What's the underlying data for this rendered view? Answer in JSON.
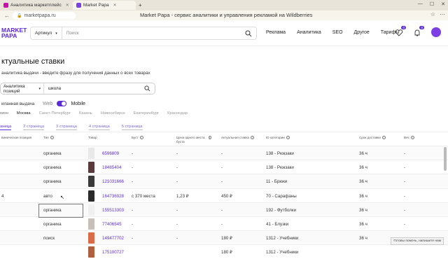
{
  "browser": {
    "tabs": [
      {
        "label": "Аналитика маркетплейс"
      },
      {
        "label": "Market Papa"
      }
    ],
    "url": "marketpapa.ru",
    "page_title": "Market Papa - сервис аналитики и управления рекламой на Wildberries"
  },
  "header": {
    "logo_line1": "MARKET",
    "logo_line2": "PAPA",
    "search_select": "Артикул",
    "search_placeholder": "Поиск",
    "nav": [
      "Реклама",
      "Аналитика",
      "SEO",
      "Другое",
      "Тарифы"
    ],
    "favorites_badge": "0",
    "notifications_badge": "0"
  },
  "page": {
    "title": "ктуальные ставки",
    "subtitle": "аналитика выдачи - введите фразу для получения данных о всех товарах",
    "mode_select": "Аналитика позиций",
    "query": "школа",
    "device_label": "иланная выдача",
    "web_label": "Web",
    "mobile_label": "Mobile",
    "regions": [
      "гион",
      "Москва",
      "Санкт-Петербург",
      "Казань",
      "Новосибирск",
      "Екатеринбург",
      "Краснодар"
    ],
    "pages": [
      "аница",
      "2 страница",
      "3 страница",
      "4 страница",
      "5 страница"
    ]
  },
  "table": {
    "columns": [
      "виническая позиция",
      "Тип",
      "Товар",
      "Буст",
      "Цена одного места буста",
      "Актуальная ставка",
      "ID категории",
      "Срок доставки",
      "Вес"
    ],
    "rows": [
      {
        "pos": "",
        "type": "органика",
        "id": "6596809",
        "boost": "-",
        "price": "-",
        "bid": "-",
        "category": "138 - Рюкзаки",
        "delivery": "36 ч",
        "weight": "-",
        "thumb": "#e8e8e8"
      },
      {
        "pos": "",
        "type": "органика",
        "id": "18485404",
        "boost": "-",
        "price": "-",
        "bid": "-",
        "category": "138 - Рюкзаки",
        "delivery": "36 ч",
        "weight": "-",
        "thumb": "#5a3a3a"
      },
      {
        "pos": "",
        "type": "органика",
        "id": "121031666",
        "boost": "-",
        "price": "-",
        "bid": "-",
        "category": "11 - Брюки",
        "delivery": "36 ч",
        "weight": "-",
        "thumb": "#3a3a3a"
      },
      {
        "pos": "4",
        "type": "авто",
        "id": "164736928",
        "boost": "с 370 места",
        "price": "1,23 ₽",
        "bid": "450 ₽",
        "category": "70 - Сарафаны",
        "delivery": "36 ч",
        "weight": "-",
        "thumb": "#2a2a2a"
      },
      {
        "pos": "",
        "type": "органика",
        "id": "155513303",
        "boost": "-",
        "price": "-",
        "bid": "-",
        "category": "192 - Футболки",
        "delivery": "36 ч",
        "weight": "-",
        "thumb": "#f0f0f0"
      },
      {
        "pos": "",
        "type": "органика",
        "id": "77406545",
        "boost": "-",
        "price": "-",
        "bid": "-",
        "category": "41 - Блузки",
        "delivery": "36 ч",
        "weight": "-",
        "thumb": "#c8c0b8"
      },
      {
        "pos": "",
        "type": "поиск",
        "id": "149477702",
        "boost": "-",
        "price": "-",
        "bid": "180 ₽",
        "category": "1312 - Учебники",
        "delivery": "36 ч",
        "weight": "-",
        "thumb": "#d96a4a"
      },
      {
        "pos": "",
        "type": "",
        "id": "175100727",
        "boost": "",
        "price": "",
        "bid": "180 ₽",
        "category": "1312 - Учебники",
        "delivery": "",
        "weight": "",
        "thumb": "#b06040"
      }
    ]
  },
  "help_text": "Готовы помочь, напишите нам"
}
